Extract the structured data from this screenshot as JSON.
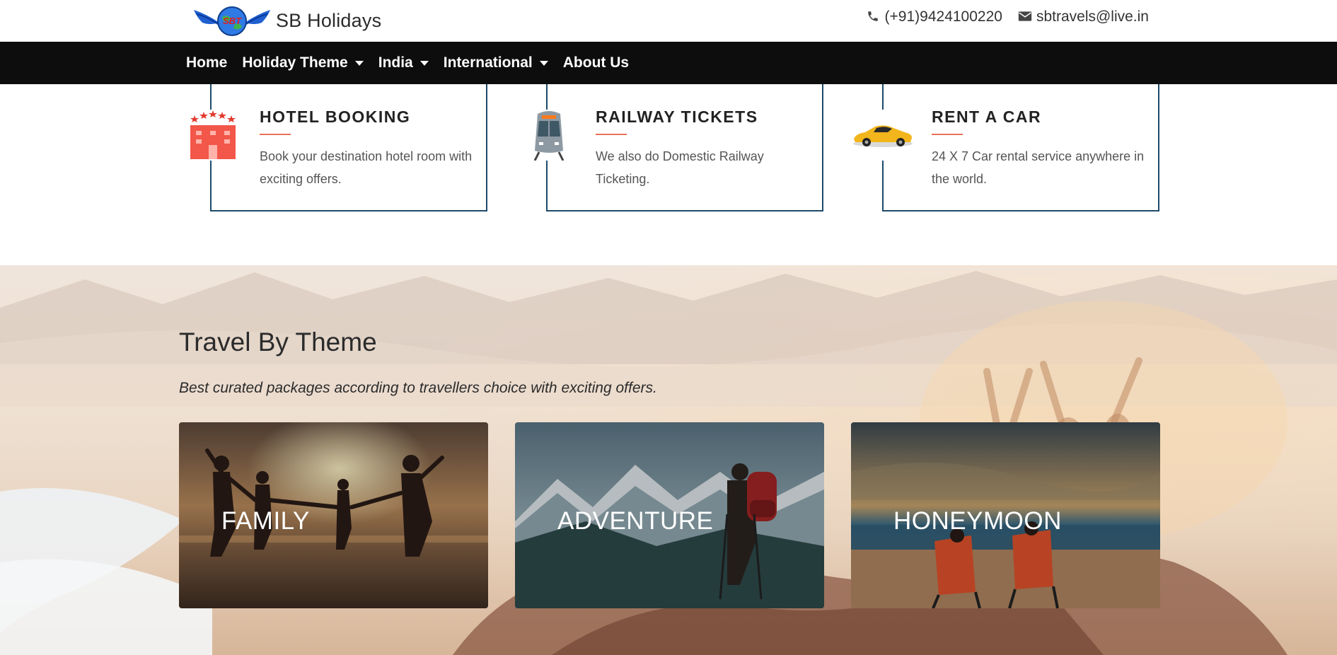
{
  "header": {
    "brand_name": "SB Holidays",
    "logo_text": "SBT",
    "phone": "(+91)9424100220",
    "email": "sbtravels@live.in"
  },
  "nav": {
    "items": [
      {
        "label": "Home",
        "dropdown": false
      },
      {
        "label": "Holiday Theme",
        "dropdown": true
      },
      {
        "label": "India",
        "dropdown": true
      },
      {
        "label": "International",
        "dropdown": true
      },
      {
        "label": "About Us",
        "dropdown": false
      }
    ]
  },
  "services": [
    {
      "title": "HOTEL BOOKING",
      "description": "Book your destination hotel room with exciting offers.",
      "icon": "hotel-icon"
    },
    {
      "title": "RAILWAY TICKETS",
      "description": "We also do Domestic Railway Ticketing.",
      "icon": "train-icon"
    },
    {
      "title": "RENT A CAR",
      "description": "24 X 7 Car rental service anywhere in the world.",
      "icon": "car-icon"
    }
  ],
  "theme_section": {
    "title": "Travel By Theme",
    "subtitle": "Best curated packages according to travellers choice with exciting offers.",
    "cards": [
      {
        "label": "FAMILY"
      },
      {
        "label": "ADVENTURE"
      },
      {
        "label": "HONEYMOON"
      }
    ]
  },
  "colors": {
    "navbar": "#0d0d0d",
    "card_border": "#1d4a6b",
    "accent_line": "#e9735a"
  }
}
